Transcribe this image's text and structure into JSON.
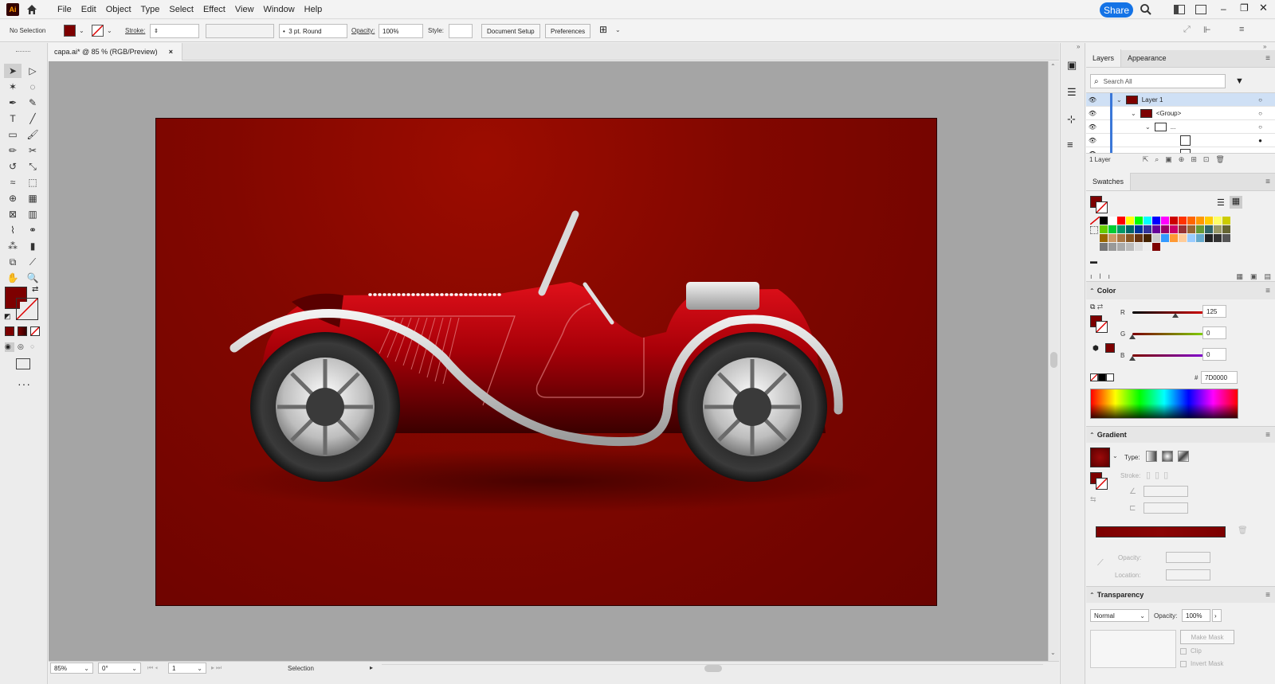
{
  "app": {
    "logo": "Ai",
    "share_label": "Share"
  },
  "menu": [
    "File",
    "Edit",
    "Object",
    "Type",
    "Select",
    "Effect",
    "View",
    "Window",
    "Help"
  ],
  "control": {
    "selection": "No Selection",
    "fill_color": "#7d0000",
    "stroke_label": "Stroke:",
    "brush": "3 pt. Round",
    "opacity_label": "Opacity:",
    "opacity": "100%",
    "style_label": "Style:",
    "document_setup": "Document Setup",
    "preferences": "Preferences"
  },
  "document": {
    "tab_title": "capa.ai* @ 85 % (RGB/Preview)",
    "close": "×"
  },
  "status": {
    "zoom": "85%",
    "rotation": "0°",
    "artboard": "1",
    "tool": "Selection"
  },
  "layers_panel": {
    "tabs": [
      "Layers",
      "Appearance"
    ],
    "search_placeholder": "Search All",
    "rows": [
      {
        "name": "Layer 1",
        "selected": true
      },
      {
        "name": "<Group>",
        "selected": false
      },
      {
        "name": "...",
        "selected": false
      },
      {
        "name": "",
        "selected": false
      },
      {
        "name": "",
        "selected": false
      }
    ],
    "footer": "1 Layer"
  },
  "swatches_panel": {
    "title": "Swatches",
    "colors": [
      "#000000",
      "#ffffff",
      "#ff0000",
      "#ffff00",
      "#00ff00",
      "#00ffff",
      "#0000ff",
      "#ff00ff",
      "#cc0000",
      "#ff3300",
      "#ff6600",
      "#ff9900",
      "#ffcc00",
      "#ffff66",
      "#cccc00",
      "#66cc00",
      "#00cc33",
      "#009966",
      "#006666",
      "#003399",
      "#333399",
      "#660099",
      "#990066",
      "#cc0066",
      "#993333",
      "#996633",
      "#669933",
      "#336666",
      "#999966",
      "#666633",
      "#996600",
      "#cc9966",
      "#aa7744",
      "#885522",
      "#663311",
      "#442200",
      "#cccccc",
      "#3399ff",
      "#ff9933",
      "#ffcc99",
      "#99ccff",
      "#66aacc",
      "#222222",
      "#333333",
      "#555555",
      "#777777",
      "#999999",
      "#aaaaaa",
      "#bbbbbb",
      "#dddddd",
      "#eeeeee",
      "#7d0000"
    ]
  },
  "color_panel": {
    "title": "Color",
    "r_label": "R",
    "r_value": "125",
    "g_label": "G",
    "g_value": "0",
    "b_label": "B",
    "b_value": "0",
    "hex_label": "#",
    "hex_value": "7D0000",
    "r_fraction": 0.49,
    "g_fraction": 0,
    "b_fraction": 0
  },
  "gradient_panel": {
    "title": "Gradient",
    "type_label": "Type:",
    "stroke_label": "Stroke:",
    "opacity_label": "Opacity:",
    "location_label": "Location:"
  },
  "transparency_panel": {
    "title": "Transparency",
    "blend_mode": "Normal",
    "opacity_label": "Opacity:",
    "opacity_value": "100%",
    "make_mask": "Make Mask",
    "clip": "Clip",
    "invert_mask": "Invert Mask"
  }
}
